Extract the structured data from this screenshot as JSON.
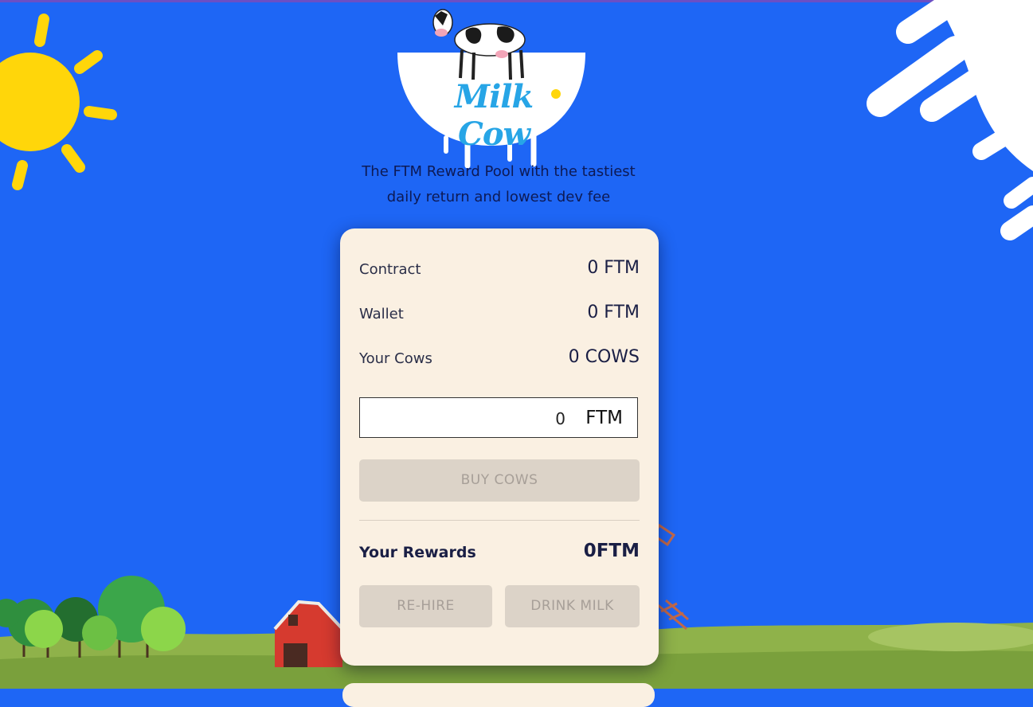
{
  "brand": {
    "logo_text": "Milk Cow"
  },
  "tagline": {
    "line1": "The FTM Reward Pool with the tastiest",
    "line2": "daily return and lowest dev fee"
  },
  "stats": {
    "contract_label": "Contract",
    "contract_value": "0 FTM",
    "wallet_label": "Wallet",
    "wallet_value": "0 FTM",
    "cows_label": "Your Cows",
    "cows_value": "0 COWS"
  },
  "deposit": {
    "amount": "0",
    "unit": "FTM"
  },
  "buttons": {
    "buy": "BUY COWS",
    "rehire": "RE-HIRE",
    "drink": "DRINK MILK"
  },
  "rewards": {
    "label": "Your Rewards",
    "value": "0FTM"
  },
  "colors": {
    "sky": "#1e66f5",
    "card": "#faf0e2",
    "sun": "#ffd60a",
    "button_disabled": "#dcd3c8",
    "text_dark": "#1a1f45"
  },
  "icons": [
    "sun-icon",
    "milk-splash-icon",
    "cow-icon",
    "barn-icon",
    "trees-icon",
    "ladder-icon"
  ]
}
